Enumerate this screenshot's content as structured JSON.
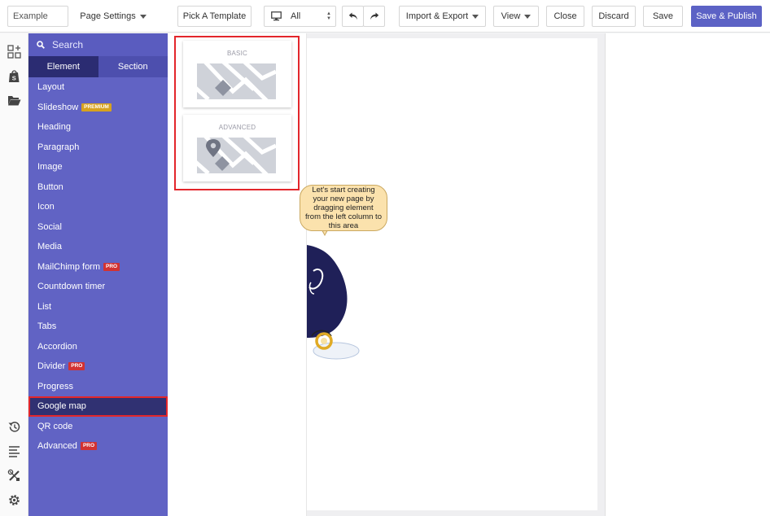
{
  "toolbar": {
    "page_name_placeholder": "Example",
    "page_settings": "Page Settings",
    "pick_template": "Pick A Template",
    "device_select": "All",
    "import_export": "Import & Export",
    "view": "View",
    "close": "Close",
    "discard": "Discard",
    "save": "Save",
    "save_publish": "Save & Publish"
  },
  "rail": {
    "icons": [
      "add-element-icon",
      "shopify-icon",
      "folder-icon",
      "history-icon",
      "outline-icon",
      "tools-icon",
      "settings-icon"
    ]
  },
  "sidebar": {
    "search_placeholder": "Search",
    "tabs": {
      "element": "Element",
      "section": "Section"
    },
    "items": [
      {
        "label": "Layout"
      },
      {
        "label": "Slideshow",
        "badge": "PREMIUM"
      },
      {
        "label": "Heading"
      },
      {
        "label": "Paragraph"
      },
      {
        "label": "Image"
      },
      {
        "label": "Button"
      },
      {
        "label": "Icon"
      },
      {
        "label": "Social"
      },
      {
        "label": "Media"
      },
      {
        "label": "MailChimp form",
        "badge": "PRO"
      },
      {
        "label": "Countdown timer"
      },
      {
        "label": "List"
      },
      {
        "label": "Tabs"
      },
      {
        "label": "Accordion"
      },
      {
        "label": "Divider",
        "badge": "PRO"
      },
      {
        "label": "Progress"
      },
      {
        "label": "Google map",
        "selected": true
      },
      {
        "label": "QR code"
      },
      {
        "label": "Advanced",
        "badge": "PRO"
      }
    ]
  },
  "panel": {
    "cards": [
      {
        "label": "BASIC"
      },
      {
        "label": "ADVANCED"
      }
    ]
  },
  "canvas": {
    "hint": "Let's start creating your new page by dragging element from the left column to this area"
  },
  "colors": {
    "accent": "#6163c4",
    "tab_active": "#2b2c72",
    "selected_item": "#303172",
    "highlight_red": "#e3262b",
    "publish": "#5c62c5",
    "premium_badge": "#d7a21f",
    "pro_badge": "#d23232",
    "bubble": "#fbe2ad",
    "mascot": "#1f2058"
  }
}
